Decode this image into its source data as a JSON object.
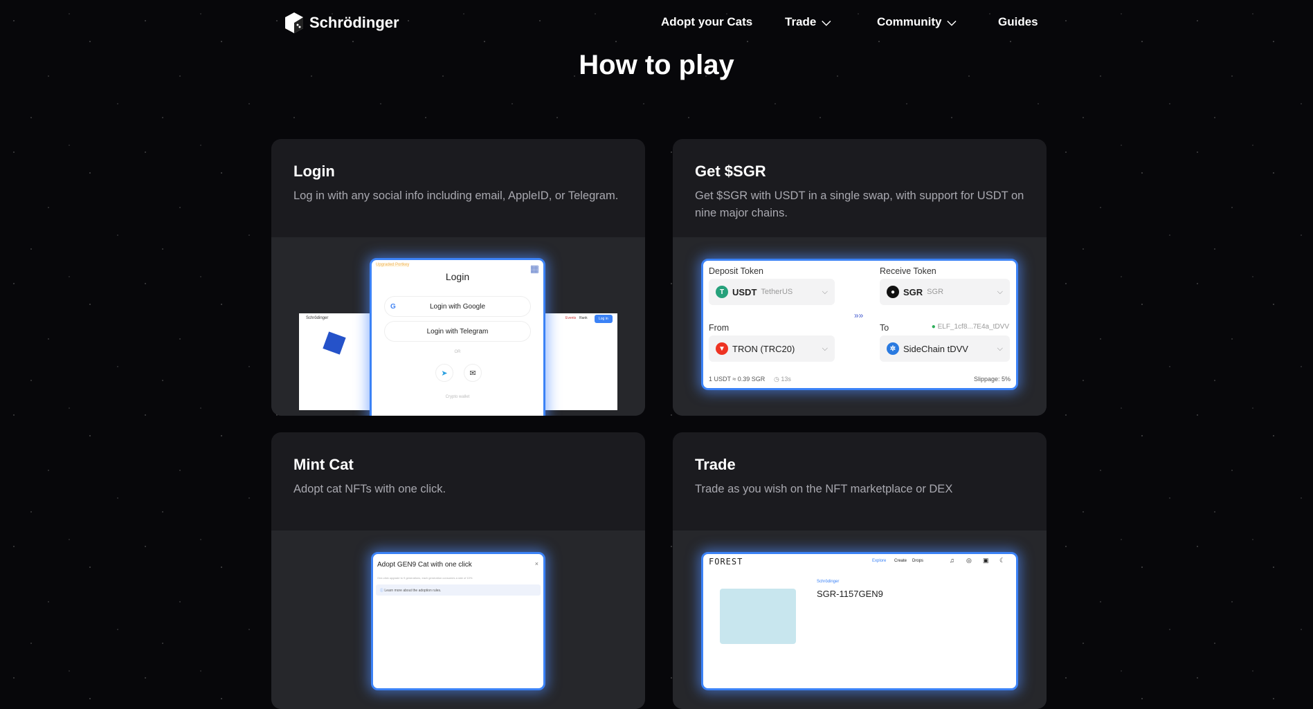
{
  "nav": {
    "brand": "Schrödinger",
    "items": [
      {
        "label": "Adopt your Cats"
      },
      {
        "label": "Trade",
        "dropdown": true
      },
      {
        "label": "Community",
        "dropdown": true
      },
      {
        "label": "Guides"
      }
    ]
  },
  "page": {
    "title": "How to play"
  },
  "cards": [
    {
      "title": "Login",
      "description": "Log in with any social info including email, AppleID, or Telegram.",
      "shot": {
        "badge": "Upgraded Portkey",
        "heading": "Login",
        "google": "Login with Google",
        "telegram": "Login with Telegram",
        "or": "OR",
        "crypto": "Crypto wallet",
        "bg_brand": "Schrödinger",
        "bg_nav": [
          "Events",
          "Rank"
        ],
        "bg_login": "Log in"
      }
    },
    {
      "title": "Get $SGR",
      "description": "Get $SGR with USDT in a single swap, with support for USDT on nine major chains.",
      "shot": {
        "deposit_label": "Deposit Token",
        "deposit_symbol": "USDT",
        "deposit_name": "TetherUS",
        "receive_label": "Receive Token",
        "receive_symbol": "SGR",
        "receive_name": "SGR",
        "from_label": "From",
        "from_chain": "TRON (TRC20)",
        "to_label": "To",
        "to_address": "ELF_1cf8...7E4a_tDVV",
        "to_chain": "SideChain tDVV",
        "rate": "1 USDT ≈ 0.39 SGR",
        "time": "13s",
        "slippage": "Slippage: 5%"
      }
    },
    {
      "title": "Mint Cat",
      "description": "Adopt cat NFTs with one click.",
      "shot": {
        "heading": "Adopt GEN9 Cat with one click",
        "subtext": "One-click upgrade to 9 generations, each generation consumes a rate of 10%",
        "info": "Learn more about the adoption rules."
      }
    },
    {
      "title": "Trade",
      "description": "Trade as you wish on the NFT marketplace or DEX",
      "shot": {
        "brand": "FOREST",
        "nav": [
          "Explore",
          "Create",
          "Drops"
        ],
        "collection": "Schrödinger",
        "item": "SGR-1157GEN9"
      }
    }
  ]
}
